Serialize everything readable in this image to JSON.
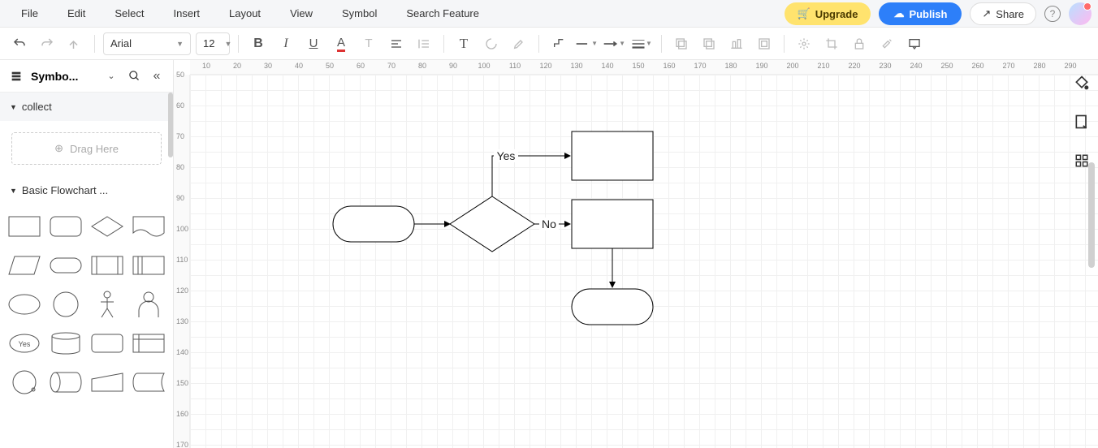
{
  "menu": {
    "items": [
      "File",
      "Edit",
      "Select",
      "Insert",
      "Layout",
      "View",
      "Symbol",
      "Search Feature"
    ],
    "upgrade": "Upgrade",
    "publish": "Publish",
    "share": "Share"
  },
  "toolbar": {
    "font": "Arial",
    "font_size": "12"
  },
  "sidebar": {
    "title": "Symbo...",
    "sections": {
      "collect": {
        "title": "collect",
        "drop_hint": "Drag Here"
      },
      "basic": {
        "title": "Basic Flowchart ..."
      }
    }
  },
  "ruler": {
    "h": [
      "10",
      "20",
      "30",
      "40",
      "50",
      "60",
      "70",
      "80",
      "90",
      "100",
      "110",
      "120",
      "130",
      "140",
      "150",
      "160",
      "170",
      "180",
      "190",
      "200",
      "210",
      "220",
      "230",
      "240",
      "250",
      "260",
      "270",
      "280",
      "290"
    ],
    "v": [
      "50",
      "60",
      "70",
      "80",
      "90",
      "100",
      "110",
      "120",
      "130",
      "140",
      "150",
      "160",
      "170"
    ]
  },
  "flow": {
    "labels": {
      "yes": "Yes",
      "no": "No"
    }
  },
  "shapes_palette": {
    "yes_label": "Yes"
  }
}
